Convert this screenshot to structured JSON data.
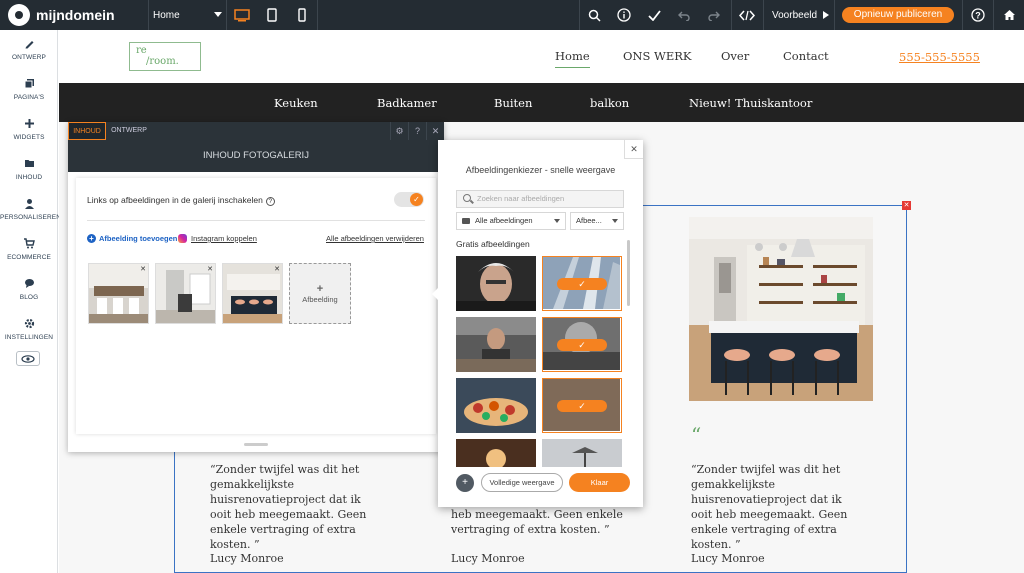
{
  "app": {
    "brand": "mijndomein",
    "page_selector": "Home",
    "preview_label": "Voorbeeld",
    "publish_label": "Opnieuw publiceren"
  },
  "toolbar_icons": [
    "desktop-icon",
    "tablet-icon",
    "mobile-icon",
    "search-icon",
    "info-icon",
    "check-icon",
    "undo-icon",
    "redo-icon",
    "code-icon",
    "help-icon",
    "home-icon"
  ],
  "sidebar": {
    "items": [
      {
        "label": "ONTWERP",
        "icon": "pencil-icon"
      },
      {
        "label": "PAGINA'S",
        "icon": "pages-icon"
      },
      {
        "label": "WIDGETS",
        "icon": "plus-icon"
      },
      {
        "label": "INHOUD",
        "icon": "folder-icon"
      },
      {
        "label": "PERSONALISEREN",
        "icon": "person-icon"
      },
      {
        "label": "ECOMMERCE",
        "icon": "cart-icon"
      },
      {
        "label": "BLOG",
        "icon": "chat-icon"
      },
      {
        "label": "INSTELLINGEN",
        "icon": "gear-icon"
      }
    ]
  },
  "site": {
    "logo_line1": "re",
    "logo_line2": "/room.",
    "nav": [
      "Home",
      "ONS WERK",
      "Over",
      "Contact"
    ],
    "phone": "555-555-5555",
    "categories": [
      "Keuken",
      "Badkamer",
      "Buiten",
      "balkon",
      "Nieuw! Thuiskantoor"
    ],
    "quote_mark": "“",
    "testimonials": [
      {
        "quote": "“Zonder twijfel was dit het gemakkelijkste huisrenovatieproject dat ik ooit heb meegemaakt. Geen enkele vertraging of extra kosten. ”",
        "author": "Lucy Monroe"
      },
      {
        "quote": "heb meegemaakt. Geen enkele vertraging of extra kosten. ”",
        "author": "Lucy Monroe"
      },
      {
        "quote": "“Zonder twijfel was dit het gemakkelijkste huisrenovatieproject dat ik ooit heb meegemaakt. Geen enkele vertraging of extra kosten. ”",
        "author": "Lucy Monroe"
      }
    ]
  },
  "panel": {
    "tabs": [
      "INHOUD",
      "ONTWERP"
    ],
    "title": "INHOUD FOTOGALERIJ",
    "toggle_label": "Links op afbeeldingen in de galerij inschakelen",
    "toggle_on": true,
    "add_image": "Afbeelding toevoegen",
    "instagram": "Instagram koppelen",
    "remove_all": "Alle afbeeldingen verwijderen",
    "add_tile": "Afbeelding"
  },
  "picker": {
    "title": "Afbeeldingenkiezer - snelle weergave",
    "search_placeholder": "Zoeken naar afbeeldingen",
    "filter_all": "Alle afbeeldingen",
    "filter_type": "Afbee...",
    "section": "Gratis afbeeldingen",
    "selected": [
      false,
      true,
      false,
      true,
      false,
      true,
      false,
      false
    ],
    "full_view": "Volledige weergave",
    "done": "Klaar"
  },
  "colors": {
    "accent": "#f58220",
    "topbar": "#242c33",
    "link": "#1e63c4",
    "brand_green": "#6aa86a"
  }
}
